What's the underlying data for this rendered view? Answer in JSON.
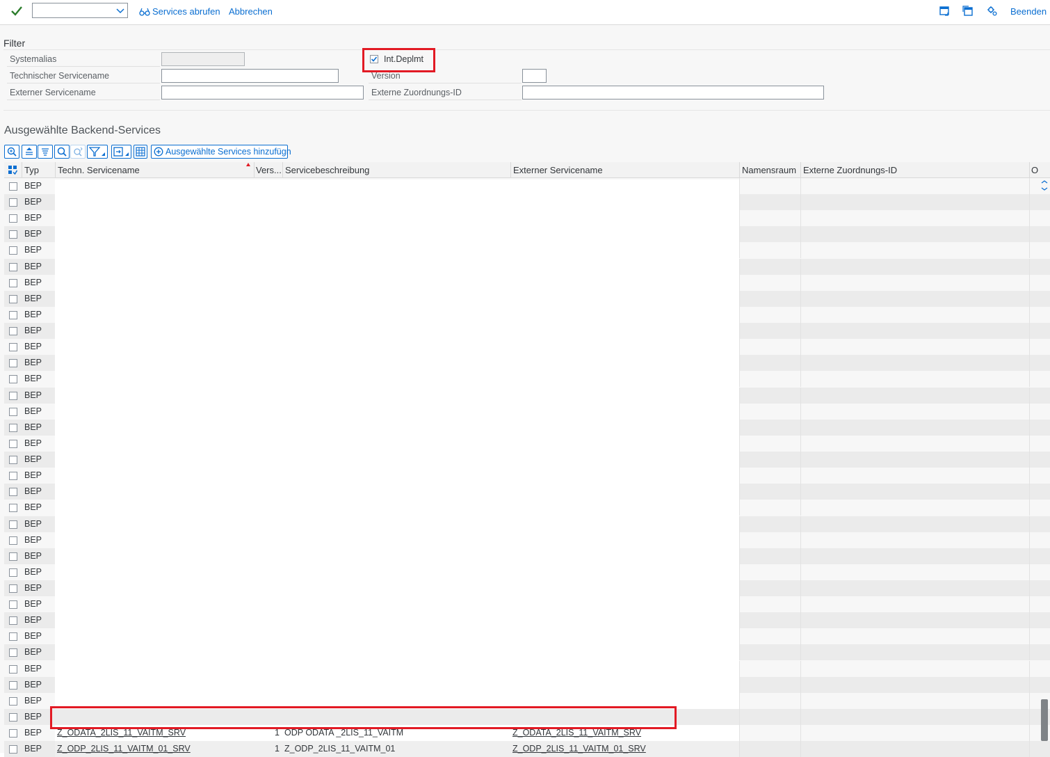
{
  "toolbar": {
    "services_abrufen": "Services abrufen",
    "abbrechen": "Abbrechen",
    "beenden": "Beenden",
    "select_value": ""
  },
  "filter": {
    "title": "Filter",
    "systemalias_label": "Systemalias",
    "systemalias_value": "",
    "technischer_label": "Technischer Servicename",
    "technischer_value": "",
    "externer_label": "Externer Servicename",
    "externer_value": "",
    "int_deplmt_label": "Int.Deplmt",
    "int_deplmt_checked": true,
    "version_label": "Version",
    "version_value": "",
    "zuordnung_label": "Externe Zuordnungs-ID",
    "zuordnung_value": ""
  },
  "section": {
    "title": "Ausgewählte Backend-Services",
    "add_button": "Ausgewählte Services hinzufügn"
  },
  "table": {
    "columns": [
      "Typ",
      "Techn. Servicename",
      "Vers...",
      "Servicebeschreibung",
      "Externer Servicename",
      "Namensraum",
      "Externe Zuordnungs-ID",
      "O"
    ],
    "rows": [
      {
        "typ": "BEP",
        "name": "",
        "vers": "",
        "desc": "",
        "ext": ""
      },
      {
        "typ": "BEP",
        "name": "",
        "vers": "",
        "desc": "",
        "ext": ""
      },
      {
        "typ": "BEP",
        "name": "",
        "vers": "",
        "desc": "",
        "ext": ""
      },
      {
        "typ": "BEP",
        "name": "",
        "vers": "",
        "desc": "",
        "ext": ""
      },
      {
        "typ": "BEP",
        "name": "",
        "vers": "",
        "desc": "",
        "ext": ""
      },
      {
        "typ": "BEP",
        "name": "",
        "vers": "",
        "desc": "",
        "ext": ""
      },
      {
        "typ": "BEP",
        "name": "",
        "vers": "",
        "desc": "",
        "ext": ""
      },
      {
        "typ": "BEP",
        "name": "",
        "vers": "",
        "desc": "",
        "ext": ""
      },
      {
        "typ": "BEP",
        "name": "",
        "vers": "",
        "desc": "",
        "ext": ""
      },
      {
        "typ": "BEP",
        "name": "",
        "vers": "",
        "desc": "",
        "ext": ""
      },
      {
        "typ": "BEP",
        "name": "",
        "vers": "",
        "desc": "",
        "ext": ""
      },
      {
        "typ": "BEP",
        "name": "",
        "vers": "",
        "desc": "",
        "ext": ""
      },
      {
        "typ": "BEP",
        "name": "",
        "vers": "",
        "desc": "",
        "ext": ""
      },
      {
        "typ": "BEP",
        "name": "",
        "vers": "",
        "desc": "",
        "ext": ""
      },
      {
        "typ": "BEP",
        "name": "",
        "vers": "",
        "desc": "",
        "ext": ""
      },
      {
        "typ": "BEP",
        "name": "",
        "vers": "",
        "desc": "",
        "ext": ""
      },
      {
        "typ": "BEP",
        "name": "",
        "vers": "",
        "desc": "",
        "ext": ""
      },
      {
        "typ": "BEP",
        "name": "",
        "vers": "",
        "desc": "",
        "ext": ""
      },
      {
        "typ": "BEP",
        "name": "",
        "vers": "",
        "desc": "",
        "ext": ""
      },
      {
        "typ": "BEP",
        "name": "",
        "vers": "",
        "desc": "",
        "ext": ""
      },
      {
        "typ": "BEP",
        "name": "",
        "vers": "",
        "desc": "",
        "ext": ""
      },
      {
        "typ": "BEP",
        "name": "",
        "vers": "",
        "desc": "",
        "ext": ""
      },
      {
        "typ": "BEP",
        "name": "",
        "vers": "",
        "desc": "",
        "ext": ""
      },
      {
        "typ": "BEP",
        "name": "",
        "vers": "",
        "desc": "",
        "ext": ""
      },
      {
        "typ": "BEP",
        "name": "",
        "vers": "",
        "desc": "",
        "ext": ""
      },
      {
        "typ": "BEP",
        "name": "",
        "vers": "",
        "desc": "",
        "ext": ""
      },
      {
        "typ": "BEP",
        "name": "",
        "vers": "",
        "desc": "",
        "ext": ""
      },
      {
        "typ": "BEP",
        "name": "",
        "vers": "",
        "desc": "",
        "ext": ""
      },
      {
        "typ": "BEP",
        "name": "",
        "vers": "",
        "desc": "",
        "ext": ""
      },
      {
        "typ": "BEP",
        "name": "",
        "vers": "",
        "desc": "",
        "ext": ""
      },
      {
        "typ": "BEP",
        "name": "",
        "vers": "",
        "desc": "",
        "ext": ""
      },
      {
        "typ": "BEP",
        "name": "",
        "vers": "",
        "desc": "",
        "ext": ""
      },
      {
        "typ": "BEP",
        "name": "",
        "vers": "",
        "desc": "",
        "ext": ""
      },
      {
        "typ": "BEP",
        "name": "",
        "vers": "",
        "desc": "",
        "ext": ""
      },
      {
        "typ": "BEP",
        "name": "Z_ODATA_2LIS_11_VAITM_SRV",
        "vers": "1",
        "desc": "ODP ODATA _2LIS_11_VAITM",
        "ext": "Z_ODATA_2LIS_11_VAITM_SRV"
      },
      {
        "typ": "BEP",
        "name": "Z_ODP_2LIS_11_VAITM_01_SRV",
        "vers": "1",
        "desc": "Z_ODP_2LIS_11_VAITM_01",
        "ext": "Z_ODP_2LIS_11_VAITM_01_SRV"
      }
    ]
  },
  "colors": {
    "accent": "#0a6ed1",
    "highlight": "#e21a24",
    "check": "#2b7d2b"
  }
}
